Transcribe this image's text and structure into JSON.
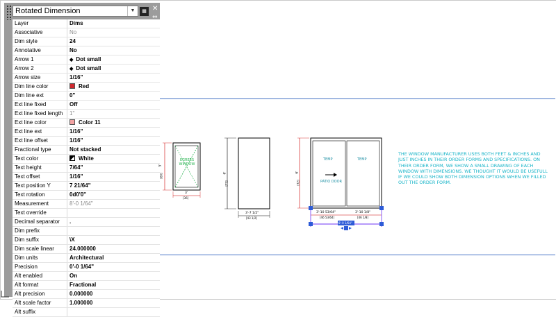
{
  "properties_palette": {
    "selected_object": "Rotated Dimension",
    "rows": [
      {
        "label": "Layer",
        "value": "Dims"
      },
      {
        "label": "Associative",
        "value": "No",
        "readonly": true
      },
      {
        "label": "Dim style",
        "value": "24"
      },
      {
        "label": "Annotative",
        "value": "No"
      },
      {
        "label": "Arrow 1",
        "value": "Dot small",
        "icon": "diamond-icon"
      },
      {
        "label": "Arrow 2",
        "value": "Dot small",
        "icon": "diamond-icon"
      },
      {
        "label": "Arrow size",
        "value": "1/16\""
      },
      {
        "label": "Dim line color",
        "value": "Red",
        "swatch": "#d0282e"
      },
      {
        "label": "Dim line ext",
        "value": "0\""
      },
      {
        "label": "Ext line fixed",
        "value": "Off"
      },
      {
        "label": "Ext line fixed length",
        "value": "1\"",
        "readonly": true
      },
      {
        "label": "Ext line color",
        "value": "Color 11",
        "swatch": "#f2a2a2"
      },
      {
        "label": "Ext line ext",
        "value": "1/16\""
      },
      {
        "label": "Ext line offset",
        "value": "1/16\""
      },
      {
        "label": "Fractional type",
        "value": "Not stacked"
      },
      {
        "label": "Text color",
        "value": "White",
        "swatch": "half"
      },
      {
        "label": "Text height",
        "value": "7/64\""
      },
      {
        "label": "Text offset",
        "value": "1/16\""
      },
      {
        "label": "Text position Y",
        "value": "7 21/64\""
      },
      {
        "label": "Text rotation",
        "value": "0d0'0\""
      },
      {
        "label": "Measurement",
        "value": "8'-0 1/64\"",
        "readonly": true
      },
      {
        "label": "Text override",
        "value": ""
      },
      {
        "label": "Decimal separator",
        "value": "."
      },
      {
        "label": "Dim prefix",
        "value": ""
      },
      {
        "label": "Dim suffix",
        "value": "\\X"
      },
      {
        "label": "Dim scale linear",
        "value": "24.000000"
      },
      {
        "label": "Dim units",
        "value": "Architectural"
      },
      {
        "label": "Precision",
        "value": "0'-0 1/64\""
      },
      {
        "label": "Alt enabled",
        "value": "On"
      },
      {
        "label": "Alt format",
        "value": "Fractional"
      },
      {
        "label": "Alt precision",
        "value": "0.000000"
      },
      {
        "label": "Alt scale factor",
        "value": "1.000000"
      },
      {
        "label": "Alt suffix",
        "value": ""
      }
    ]
  },
  "drawing": {
    "window1": {
      "label": "EGRESS WINDOW",
      "width_dim": "3'",
      "width_alt": "[36]",
      "height_dim": "5'",
      "height_alt": "[60]"
    },
    "window2": {
      "width_dim": "3'-7 1/2\"",
      "width_alt": "[43 1/2]",
      "height_dim": "6'",
      "height_alt": "[72]"
    },
    "patio_door": {
      "label": "PATIO DOOR",
      "left_panel": "TEMP",
      "right_panel": "TEMP",
      "left_width_dim": "3'-10 53/64\"",
      "left_width_alt": "[46 53/64]",
      "right_width_dim": "3'-10 1/8\"",
      "right_width_alt": "[46 1/8]",
      "overall_dim": "8'-0 1/64\"",
      "height_dim": "6'",
      "height_alt": "[72]"
    },
    "note": "THE WINDOW MANUFACTURER USES BOTH FEET & INCHES AND JUST INCHES IN THEIR ORDER FORMS AND SPECIFICATIONS.  ON THEIR ORDER FORM, WE SHOW A SMALL DRAWING OF EACH WINDOW WITH DIMENSIONS. WE THOUGHT IT WOULD BE USEFULL IF WE COULD SHOW BOTH DIMENSION OPTIONS WHEN WE FILLED OUT THE ORDER FORM."
  },
  "colors": {
    "guide_line": "#4472c4",
    "note_text": "#18b4c8",
    "grip": "#2d5bd7",
    "selection": "#8b5cf6"
  }
}
